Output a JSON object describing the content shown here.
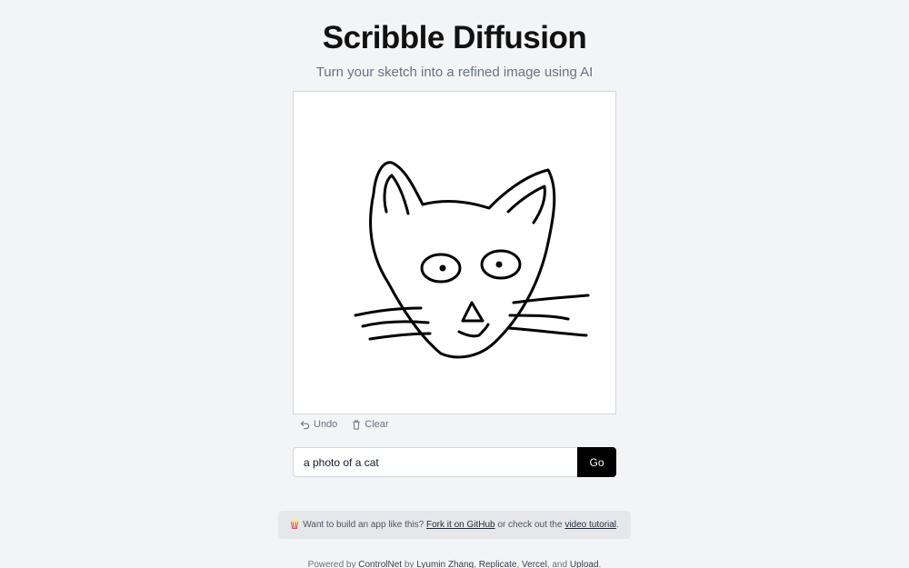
{
  "header": {
    "title": "Scribble Diffusion",
    "subtitle": "Turn your sketch into a refined image using AI"
  },
  "canvas_tools": {
    "undo_label": "Undo",
    "undo_icon": "undo-icon",
    "clear_label": "Clear",
    "clear_icon": "trash-icon"
  },
  "prompt": {
    "value": "a photo of a cat",
    "submit_label": "Go"
  },
  "promo": {
    "icon": "popcorn-icon",
    "text_before": "Want to build an app like this?",
    "fork_link": "Fork it on GitHub",
    "text_middle": "or check out the",
    "video_link": "video tutorial",
    "text_end": "."
  },
  "footer": {
    "powered_by": "Powered by",
    "controlnet_link": "ControlNet",
    "by": "by",
    "author_link": "Lyumin Zhang",
    "sep1": ",",
    "replicate_link": "Replicate",
    "sep2": ",",
    "vercel_link": "Vercel",
    "and": ", and",
    "upload_link": "Upload",
    "end": "."
  },
  "colors": {
    "background": "#f3f4f6",
    "button": "#000000",
    "accent_icon": "#dc2626"
  }
}
